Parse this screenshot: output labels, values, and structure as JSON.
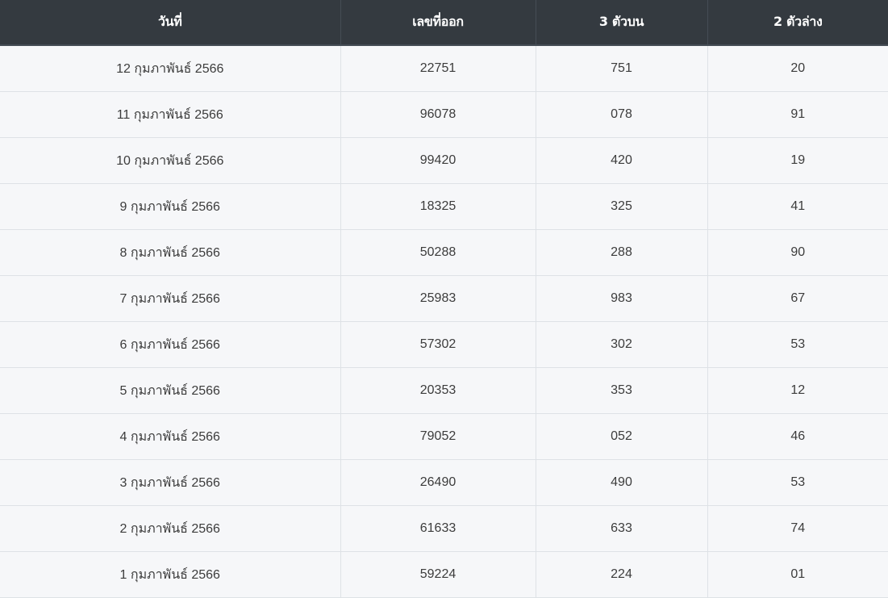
{
  "table": {
    "headers": [
      "วันที่",
      "เลขที่ออก",
      "3 ตัวบน",
      "2 ตัวล่าง"
    ],
    "rows": [
      [
        "12 กุมภาพันธ์ 2566",
        "22751",
        "751",
        "20"
      ],
      [
        "11 กุมภาพันธ์ 2566",
        "96078",
        "078",
        "91"
      ],
      [
        "10 กุมภาพันธ์ 2566",
        "99420",
        "420",
        "19"
      ],
      [
        "9 กุมภาพันธ์ 2566",
        "18325",
        "325",
        "41"
      ],
      [
        "8 กุมภาพันธ์ 2566",
        "50288",
        "288",
        "90"
      ],
      [
        "7 กุมภาพันธ์ 2566",
        "25983",
        "983",
        "67"
      ],
      [
        "6 กุมภาพันธ์ 2566",
        "57302",
        "302",
        "53"
      ],
      [
        "5 กุมภาพันธ์ 2566",
        "20353",
        "353",
        "12"
      ],
      [
        "4 กุมภาพันธ์ 2566",
        "79052",
        "052",
        "46"
      ],
      [
        "3 กุมภาพันธ์ 2566",
        "26490",
        "490",
        "53"
      ],
      [
        "2 กุมภาพันธ์ 2566",
        "61633",
        "633",
        "74"
      ],
      [
        "1 กุมภาพันธ์ 2566",
        "59224",
        "224",
        "01"
      ]
    ]
  },
  "colors": {
    "header_bg": "#343a40",
    "header_text": "#ffffff",
    "row_bg": "#f6f7f9",
    "cell_text": "#3c3c3c",
    "border": "#dee2e6"
  }
}
